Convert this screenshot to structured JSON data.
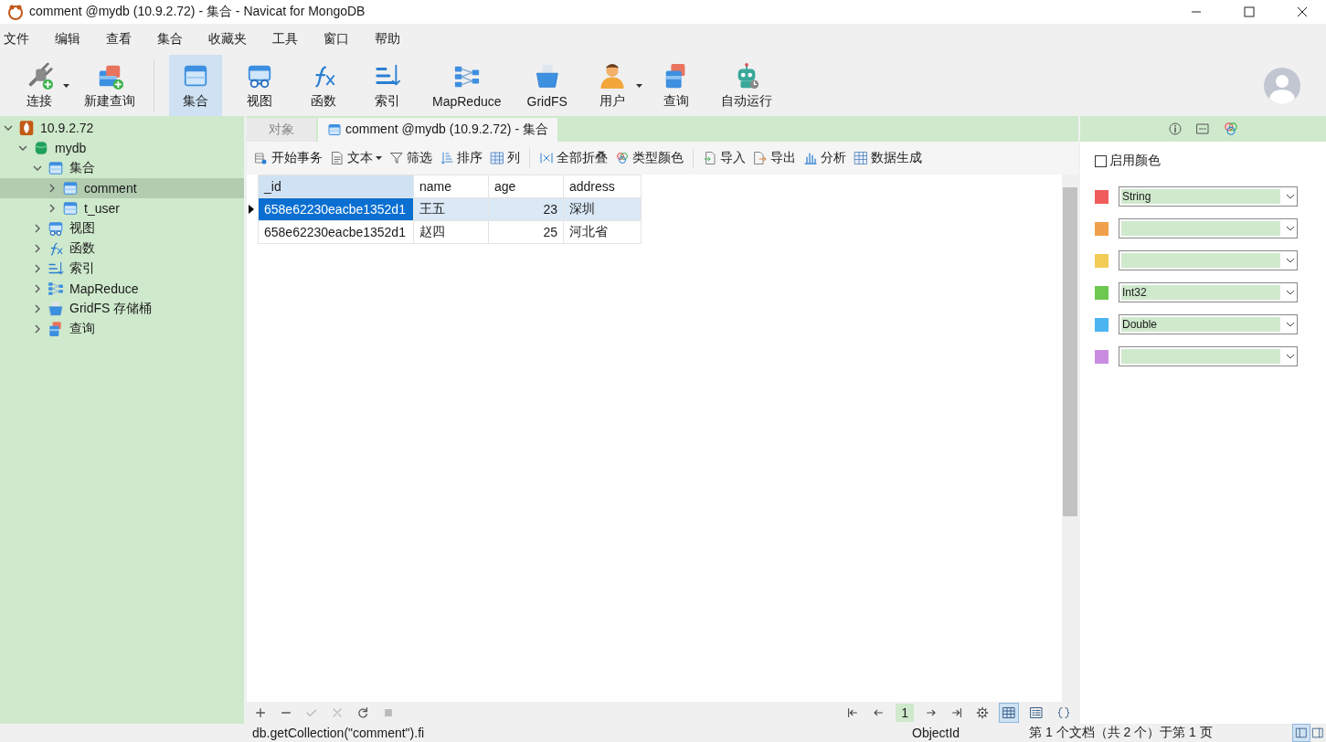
{
  "window": {
    "title": "comment @mydb (10.9.2.72) - 集合 - Navicat for MongoDB"
  },
  "menu": [
    "文件",
    "编辑",
    "查看",
    "集合",
    "收藏夹",
    "工具",
    "窗口",
    "帮助"
  ],
  "toolbar": [
    {
      "label": "连接",
      "kind": "connect",
      "selected": false,
      "dropdown": true
    },
    {
      "label": "新建查询",
      "kind": "newquery",
      "selected": false,
      "dropdown": false
    },
    {
      "label": "集合",
      "kind": "collection",
      "selected": true,
      "dropdown": false
    },
    {
      "label": "视图",
      "kind": "view",
      "selected": false,
      "dropdown": false
    },
    {
      "label": "函数",
      "kind": "function",
      "selected": false,
      "dropdown": false
    },
    {
      "label": "索引",
      "kind": "index",
      "selected": false,
      "dropdown": false
    },
    {
      "label": "MapReduce",
      "kind": "mapreduce",
      "selected": false,
      "dropdown": false
    },
    {
      "label": "GridFS",
      "kind": "gridfs",
      "selected": false,
      "dropdown": false
    },
    {
      "label": "用户",
      "kind": "user",
      "selected": false,
      "dropdown": true
    },
    {
      "label": "查询",
      "kind": "query",
      "selected": false,
      "dropdown": false
    },
    {
      "label": "自动运行",
      "kind": "robot",
      "selected": false,
      "dropdown": false
    }
  ],
  "tree": [
    {
      "label": "10.9.2.72",
      "kind": "server",
      "expanded": true,
      "selected": false,
      "children": [
        {
          "label": "mydb",
          "kind": "database",
          "expanded": true,
          "selected": false,
          "children": [
            {
              "label": "集合",
              "kind": "collection",
              "expanded": true,
              "selected": false,
              "children": [
                {
                  "label": "comment",
                  "kind": "collection",
                  "expanded": false,
                  "selected": true
                },
                {
                  "label": "t_user",
                  "kind": "collection",
                  "expanded": false,
                  "selected": false
                }
              ]
            },
            {
              "label": "视图",
              "kind": "view",
              "expanded": false,
              "selected": false
            },
            {
              "label": "函数",
              "kind": "function",
              "expanded": false,
              "selected": false
            },
            {
              "label": "索引",
              "kind": "index",
              "expanded": false,
              "selected": false
            },
            {
              "label": "MapReduce",
              "kind": "mapreduce",
              "expanded": false,
              "selected": false
            },
            {
              "label": "GridFS 存储桶",
              "kind": "gridfs",
              "expanded": false,
              "selected": false
            },
            {
              "label": "查询",
              "kind": "query",
              "expanded": false,
              "selected": false
            }
          ]
        }
      ]
    }
  ],
  "tabs": [
    {
      "label": "对象",
      "kind": "plain",
      "selected": false
    },
    {
      "label": "comment @mydb (10.9.2.72) - 集合",
      "kind": "collection",
      "selected": true
    }
  ],
  "grid_toolbar": [
    {
      "label": "开始事务",
      "kind": "transaction",
      "dropdown": false
    },
    {
      "label": "文本",
      "kind": "text",
      "dropdown": true
    },
    {
      "label": "筛选",
      "kind": "filter",
      "dropdown": false
    },
    {
      "label": "排序",
      "kind": "sort",
      "dropdown": false
    },
    {
      "label": "列",
      "kind": "columns",
      "dropdown": false
    },
    {
      "label": "全部折叠",
      "kind": "collapse",
      "dropdown": false
    },
    {
      "label": "类型颜色",
      "kind": "colors",
      "dropdown": false
    },
    {
      "label": "导入",
      "kind": "import",
      "dropdown": false
    },
    {
      "label": "导出",
      "kind": "export",
      "dropdown": false
    },
    {
      "label": "分析",
      "kind": "analyze",
      "dropdown": false
    },
    {
      "label": "数据生成",
      "kind": "generate",
      "dropdown": false
    }
  ],
  "table": {
    "columns": [
      {
        "label": "_id",
        "kind": "text"
      },
      {
        "label": "name",
        "kind": "text"
      },
      {
        "label": "age",
        "kind": "number"
      },
      {
        "label": "address",
        "kind": "text"
      }
    ],
    "rows": [
      {
        "selected": true,
        "cells": [
          "658e62230eacbe1352d1",
          "王五",
          "23",
          "深圳"
        ]
      },
      {
        "selected": false,
        "cells": [
          "658e62230eacbe1352d1",
          "赵四",
          "25",
          "河北省"
        ]
      }
    ]
  },
  "pager": {
    "page": "1"
  },
  "color_panel": {
    "enable": {
      "label": "启用颜色",
      "checked": false
    },
    "rows": [
      {
        "color": "#f05c5c",
        "value": "String"
      },
      {
        "color": "#f0a04a"
      },
      {
        "color": "#f2cc55"
      },
      {
        "color": "#6cc84e",
        "value": "Int32"
      },
      {
        "color": "#4cb4f0",
        "value": "Double"
      },
      {
        "color": "#c98ce0"
      }
    ]
  },
  "status_bar": {
    "query": "db.getCollection(\"comment\").fi",
    "type": "ObjectId",
    "info": "第 1 个文档（共 2 个）于第 1 页"
  }
}
